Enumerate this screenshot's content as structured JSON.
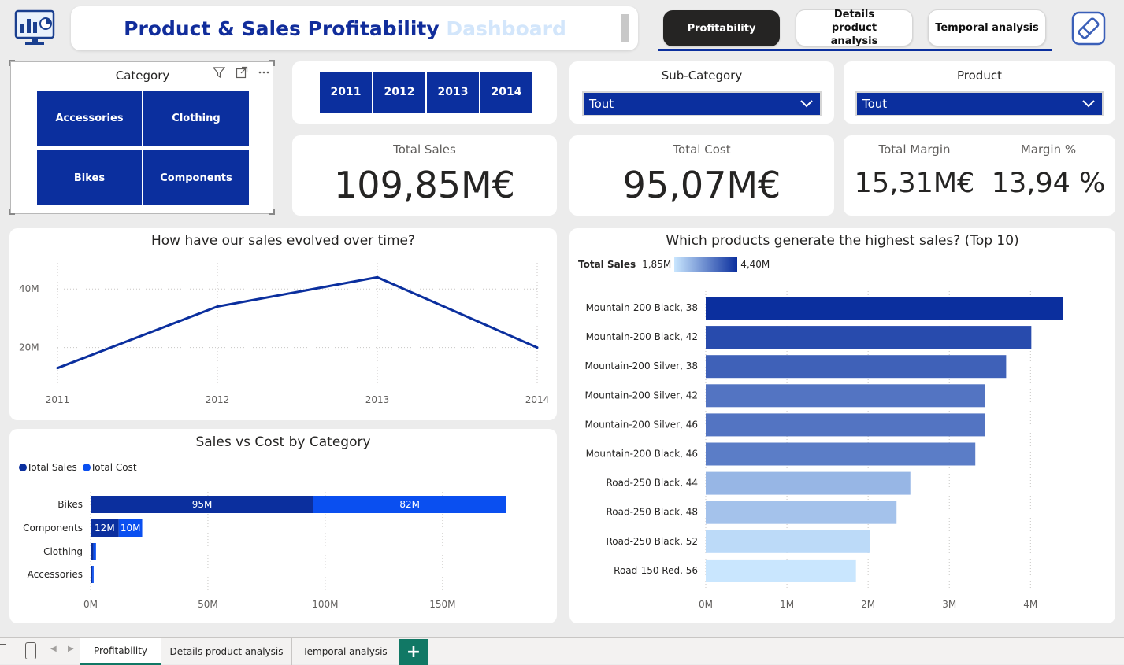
{
  "header": {
    "title_part1": "Product & Sales Profitability",
    "title_part2": "Dashboard",
    "nav": [
      "Profitability",
      "Details product analysis",
      "Temporal analysis"
    ],
    "active_nav": "Profitability"
  },
  "slicers": {
    "category": {
      "title": "Category",
      "options": [
        "Accessories",
        "Clothing",
        "Bikes",
        "Components"
      ]
    },
    "years": [
      "2011",
      "2012",
      "2013",
      "2014"
    ],
    "subcategory": {
      "title": "Sub-Category",
      "value": "Tout"
    },
    "product": {
      "title": "Product",
      "value": "Tout"
    }
  },
  "kpis": {
    "total_sales": {
      "label": "Total Sales",
      "value": "109,85M€"
    },
    "total_cost": {
      "label": "Total Cost",
      "value": "95,07M€"
    },
    "total_margin": {
      "label": "Total Margin",
      "value": "15,31M€"
    },
    "margin_pct": {
      "label": "Margin %",
      "value": "13,94 %"
    }
  },
  "charts": {
    "sales_time": {
      "title": "How have our sales evolved over time?",
      "y_ticks": [
        "40M",
        "20M"
      ]
    },
    "sales_cost": {
      "title": "Sales vs Cost by Category",
      "x_ticks": [
        "0M",
        "50M",
        "100M",
        "150M"
      ]
    },
    "top_products": {
      "title": "Which products generate the highest sales? (Top 10)",
      "legend_label": "Total Sales",
      "legend_min": "1,85M",
      "legend_max": "4,40M",
      "x_ticks": [
        "0M",
        "1M",
        "2M",
        "3M",
        "4M"
      ]
    }
  },
  "chart_data": [
    {
      "type": "line",
      "x": [
        "2011",
        "2012",
        "2013",
        "2014"
      ],
      "series": [
        {
          "values": [
            13,
            34,
            44,
            20
          ]
        }
      ],
      "ylim": [
        7,
        50
      ]
    },
    {
      "type": "bar",
      "orientation": "horizontal-stacked",
      "categories": [
        "Bikes",
        "Components",
        "Clothing",
        "Accessories"
      ],
      "series": [
        {
          "name": "Total Sales",
          "values": [
            95,
            12,
            1.2,
            0.7
          ],
          "labels": [
            "95M",
            "12M",
            "",
            ""
          ],
          "color": "#0b2f9e"
        },
        {
          "name": "Total Cost",
          "values": [
            82,
            10,
            1.1,
            0.6
          ],
          "labels": [
            "82M",
            "10M",
            "",
            ""
          ],
          "color": "#0a4ff0"
        }
      ],
      "xlim": [
        0,
        190
      ]
    },
    {
      "type": "bar",
      "orientation": "horizontal",
      "categories": [
        "Mountain-200 Black, 38",
        "Mountain-200 Black, 42",
        "Mountain-200 Silver, 38",
        "Mountain-200 Silver, 42",
        "Mountain-200 Silver, 46",
        "Mountain-200 Black, 46",
        "Road-250 Black, 44",
        "Road-250 Black, 48",
        "Road-250 Black, 52",
        "Road-150 Red, 56"
      ],
      "values": [
        4.4,
        4.01,
        3.7,
        3.44,
        3.44,
        3.32,
        2.52,
        2.35,
        2.02,
        1.85
      ],
      "xlim": [
        0,
        4.55
      ],
      "color_min": "#c9e6fe",
      "color_max": "#0b2f9e"
    }
  ],
  "tabs": [
    "Profitability",
    "Details product analysis",
    "Temporal analysis"
  ],
  "colors": {
    "accent": "#0b2f9e",
    "accent2": "#0a4ff0",
    "tab_active": "#117865"
  }
}
